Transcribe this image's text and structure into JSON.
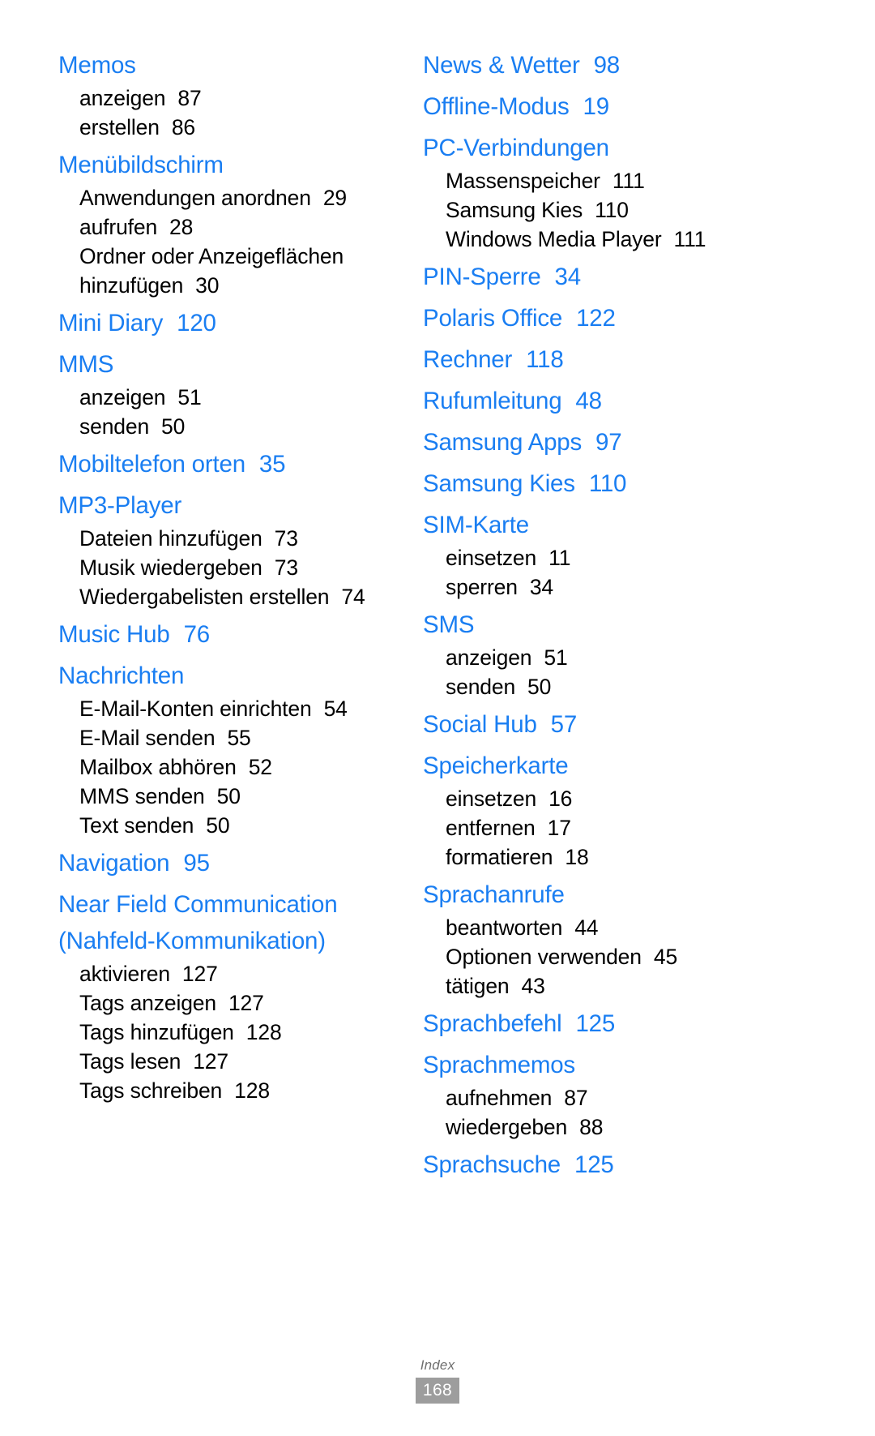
{
  "footer": {
    "label": "Index",
    "page_number": "168",
    "badge_color": "#9d9d9d",
    "label_color": "#6f6f6f"
  },
  "theme": {
    "heading_color": "#1a7ef2",
    "body_color": "#000000",
    "background": "#ffffff"
  },
  "columns": [
    {
      "name": "left-column",
      "entries": [
        {
          "title": "Memos",
          "page": "",
          "subs": [
            {
              "label": "anzeigen",
              "page": "87"
            },
            {
              "label": "erstellen",
              "page": "86"
            }
          ]
        },
        {
          "title": "Menübildschirm",
          "page": "",
          "subs": [
            {
              "label": "Anwendungen anordnen",
              "page": "29"
            },
            {
              "label": "aufrufen",
              "page": "28"
            },
            {
              "label": "Ordner oder Anzeigeflächen hinzufügen",
              "page": "30"
            }
          ]
        },
        {
          "title": "Mini Diary",
          "page": "120",
          "subs": []
        },
        {
          "title": "MMS",
          "page": "",
          "subs": [
            {
              "label": "anzeigen",
              "page": "51"
            },
            {
              "label": "senden",
              "page": "50"
            }
          ]
        },
        {
          "title": "Mobiltelefon orten",
          "page": "35",
          "subs": []
        },
        {
          "title": "MP3-Player",
          "page": "",
          "subs": [
            {
              "label": "Dateien hinzufügen",
              "page": "73"
            },
            {
              "label": "Musik wiedergeben",
              "page": "73"
            },
            {
              "label": "Wiedergabelisten erstellen",
              "page": "74"
            }
          ]
        },
        {
          "title": "Music Hub",
          "page": "76",
          "subs": []
        },
        {
          "title": "Nachrichten",
          "page": "",
          "subs": [
            {
              "label": "E-Mail-Konten einrichten",
              "page": "54"
            },
            {
              "label": "E-Mail senden",
              "page": "55"
            },
            {
              "label": "Mailbox abhören",
              "page": "52"
            },
            {
              "label": "MMS senden",
              "page": "50"
            },
            {
              "label": "Text senden",
              "page": "50"
            }
          ]
        },
        {
          "title": "Navigation",
          "page": "95",
          "subs": []
        },
        {
          "title": "Near Field Communication (Nahfeld-Kommunikation)",
          "page": "",
          "subs": [
            {
              "label": "aktivieren",
              "page": "127"
            },
            {
              "label": "Tags anzeigen",
              "page": "127"
            },
            {
              "label": "Tags hinzufügen",
              "page": "128"
            },
            {
              "label": "Tags lesen",
              "page": "127"
            },
            {
              "label": "Tags schreiben",
              "page": "128"
            }
          ]
        }
      ]
    },
    {
      "name": "right-column",
      "entries": [
        {
          "title": "News & Wetter",
          "page": "98",
          "subs": []
        },
        {
          "title": "Offline-Modus",
          "page": "19",
          "subs": []
        },
        {
          "title": "PC-Verbindungen",
          "page": "",
          "subs": [
            {
              "label": "Massenspeicher",
              "page": "111"
            },
            {
              "label": "Samsung Kies",
              "page": "110"
            },
            {
              "label": "Windows Media Player",
              "page": "111"
            }
          ]
        },
        {
          "title": "PIN-Sperre",
          "page": "34",
          "subs": []
        },
        {
          "title": "Polaris Office",
          "page": "122",
          "subs": []
        },
        {
          "title": "Rechner",
          "page": "118",
          "subs": []
        },
        {
          "title": "Rufumleitung",
          "page": "48",
          "subs": []
        },
        {
          "title": "Samsung Apps",
          "page": "97",
          "subs": []
        },
        {
          "title": "Samsung Kies",
          "page": "110",
          "subs": []
        },
        {
          "title": "SIM-Karte",
          "page": "",
          "subs": [
            {
              "label": "einsetzen",
              "page": "11"
            },
            {
              "label": "sperren",
              "page": "34"
            }
          ]
        },
        {
          "title": "SMS",
          "page": "",
          "subs": [
            {
              "label": "anzeigen",
              "page": "51"
            },
            {
              "label": "senden",
              "page": "50"
            }
          ]
        },
        {
          "title": "Social Hub",
          "page": "57",
          "subs": []
        },
        {
          "title": "Speicherkarte",
          "page": "",
          "subs": [
            {
              "label": "einsetzen",
              "page": "16"
            },
            {
              "label": "entfernen",
              "page": "17"
            },
            {
              "label": "formatieren",
              "page": "18"
            }
          ]
        },
        {
          "title": "Sprachanrufe",
          "page": "",
          "subs": [
            {
              "label": "beantworten",
              "page": "44"
            },
            {
              "label": "Optionen verwenden",
              "page": "45"
            },
            {
              "label": "tätigen",
              "page": "43"
            }
          ]
        },
        {
          "title": "Sprachbefehl",
          "page": "125",
          "subs": []
        },
        {
          "title": "Sprachmemos",
          "page": "",
          "subs": [
            {
              "label": "aufnehmen",
              "page": "87"
            },
            {
              "label": "wiedergeben",
              "page": "88"
            }
          ]
        },
        {
          "title": "Sprachsuche",
          "page": "125",
          "subs": []
        }
      ]
    }
  ]
}
